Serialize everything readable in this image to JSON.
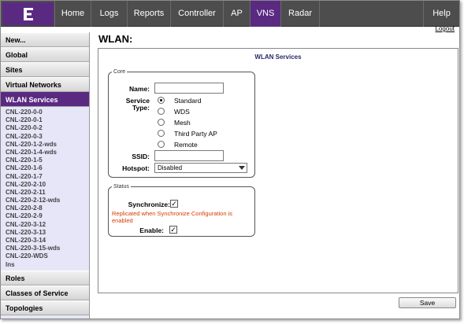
{
  "nav": {
    "items": [
      {
        "label": "Home"
      },
      {
        "label": "Logs"
      },
      {
        "label": "Reports"
      },
      {
        "label": "Controller"
      },
      {
        "label": "AP"
      },
      {
        "label": "VNS",
        "active": true
      },
      {
        "label": "Radar"
      },
      {
        "label": "Help"
      }
    ],
    "logo_icon": "extreme-logo-icon",
    "accent_color": "#5a2a82",
    "bar_color": "#4d4d4d"
  },
  "logout_label": "Logout",
  "sidebar": {
    "top_items": [
      {
        "label": "New..."
      },
      {
        "label": "Global"
      },
      {
        "label": "Sites"
      },
      {
        "label": "Virtual Networks"
      },
      {
        "label": "WLAN Services",
        "active": true
      }
    ],
    "wlan_list": [
      "CNL-220-0-0",
      "CNL-220-0-1",
      "CNL-220-0-2",
      "CNL-220-0-3",
      "CNL-220-1-2-wds",
      "CNL-220-1-4-wds",
      "CNL-220-1-5",
      "CNL-220-1-6",
      "CNL-220-1-7",
      "CNL-220-2-10",
      "CNL-220-2-11",
      "CNL-220-2-12-wds",
      "CNL-220-2-8",
      "CNL-220-2-9",
      "CNL-220-3-12",
      "CNL-220-3-13",
      "CNL-220-3-14",
      "CNL-220-3-15-wds",
      "CNL-220-WDS",
      "lns"
    ],
    "bottom_items": [
      {
        "label": "Roles"
      },
      {
        "label": "Classes of Service"
      },
      {
        "label": "Topologies"
      }
    ]
  },
  "main": {
    "page_title": "WLAN:",
    "panel_title": "WLAN Services",
    "core": {
      "legend": "Core",
      "name_label": "Name:",
      "name_value": "",
      "service_type_label_1": "Service",
      "service_type_label_2": "Type:",
      "service_types": [
        {
          "label": "Standard",
          "checked": true
        },
        {
          "label": "WDS",
          "checked": false
        },
        {
          "label": "Mesh",
          "checked": false
        },
        {
          "label": "Third Party AP",
          "checked": false
        },
        {
          "label": "Remote",
          "checked": false
        }
      ],
      "ssid_label": "SSID:",
      "ssid_value": "",
      "hotspot_label": "Hotspot:",
      "hotspot_value": "Disabled"
    },
    "status": {
      "legend": "Status",
      "synchronize_label": "Synchronize:",
      "synchronize_checked": true,
      "note_line_1": "Replicated when Synchronize Configuration is",
      "note_line_2": "enabled",
      "note_color": "#d43c00",
      "enable_label": "Enable:",
      "enable_checked": true
    },
    "save_label": "Save"
  }
}
